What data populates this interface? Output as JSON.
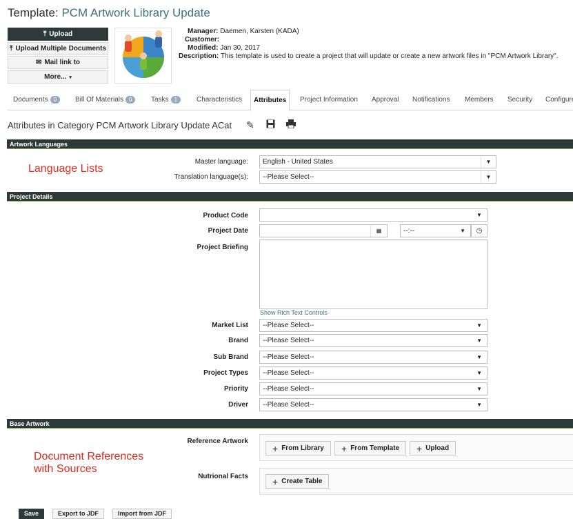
{
  "header": {
    "title_prefix": "Template:",
    "title_name": "PCM Artwork Library Update"
  },
  "actions": {
    "upload": "Upload",
    "upload_multiple": "Upload Multiple Documents",
    "mail_link": "Mail link to",
    "more": "More..."
  },
  "meta": {
    "manager_label": "Manager:",
    "manager_value": "Daemen, Karsten (KADA)",
    "customer_label": "Customer:",
    "customer_value": "",
    "modified_label": "Modified:",
    "modified_value": "Jan 30, 2017",
    "description_label": "Description:",
    "description_value": "This template is used to create a project that will update or create a new artwork files in \"PCM Artwork Library\"."
  },
  "tabs": [
    {
      "label": "Documents",
      "badge": "0"
    },
    {
      "label": "Bill Of Materials",
      "badge": "0"
    },
    {
      "label": "Tasks",
      "badge": "1"
    },
    {
      "label": "Characteristics"
    },
    {
      "label": "Attributes",
      "active": true
    },
    {
      "label": "Project Information"
    },
    {
      "label": "Approval"
    },
    {
      "label": "Notifications"
    },
    {
      "label": "Members"
    },
    {
      "label": "Security"
    },
    {
      "label": "Configure"
    }
  ],
  "page": {
    "subtitle": "Attributes in Category PCM Artwork Library Update ACat",
    "icons": [
      "pencil-icon",
      "save-icon",
      "print-icon"
    ]
  },
  "sections": {
    "languages": {
      "title": "Artwork Languages",
      "annotation": "Language Lists",
      "master_label": "Master language:",
      "master_value": "English - United States",
      "translation_label": "Translation language(s):",
      "translation_value": "--Please Select--"
    },
    "project": {
      "title": "Project Details",
      "product_code_label": "Product Code",
      "product_code_value": "",
      "project_date_label": "Project Date",
      "project_date_value": "",
      "project_time_value": "--:--",
      "briefing_label": "Project Briefing",
      "briefing_value": "",
      "rich_text": "Show Rich Text Controls",
      "market_label": "Market List",
      "market_value": "--Please Select--",
      "brand_label": "Brand",
      "brand_value": "--Please Select--",
      "subbrand_label": "Sub Brand",
      "subbrand_value": "--Please Select--",
      "types_label": "Project Types",
      "types_value": "--Please Select--",
      "priority_label": "Priority",
      "priority_value": "--Please Select--",
      "driver_label": "Driver",
      "driver_value": "--Please Select--"
    },
    "base": {
      "title": "Base Artwork",
      "annotation_line1": "Document References",
      "annotation_line2": "with Sources",
      "reference_label": "Reference Artwork",
      "from_library": "From Library",
      "from_template": "From Template",
      "upload": "Upload",
      "nutrition_label": "Nutrional Facts",
      "create_table": "Create Table"
    }
  },
  "footer": {
    "save": "Save",
    "export": "Export to JDF",
    "import": "Import from JDF"
  },
  "colors": {
    "section_bar": "#2e3a3a",
    "accent_green": "#7fb33f",
    "annotation_red": "#e02a1f",
    "title_blue": "#3f6f86"
  }
}
